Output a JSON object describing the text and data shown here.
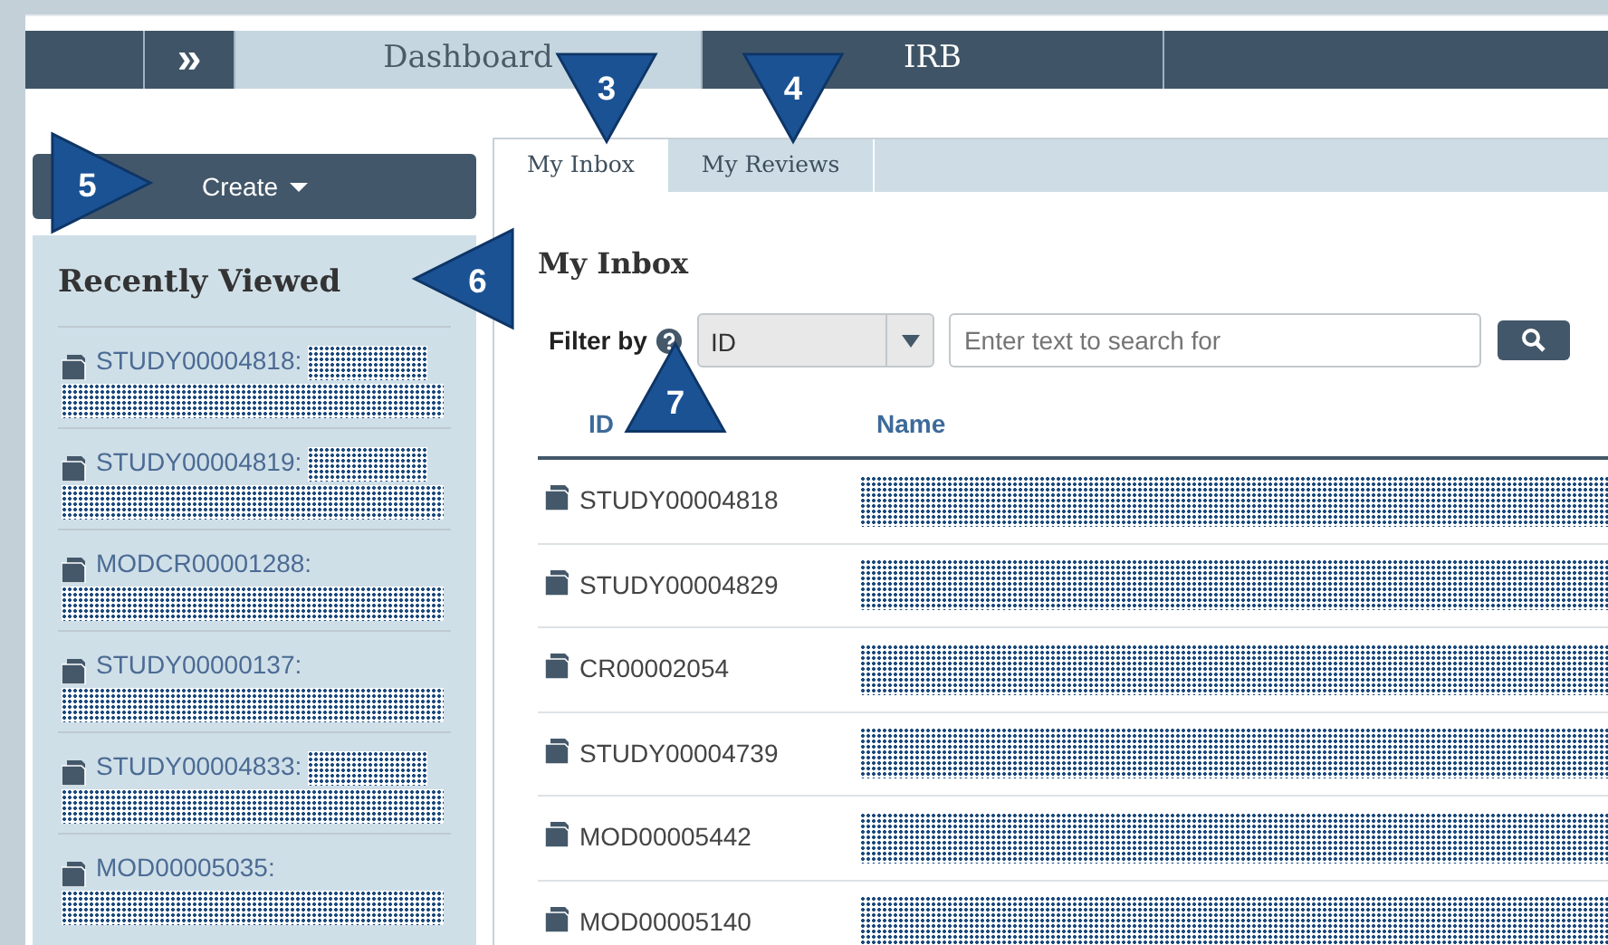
{
  "top_nav": {
    "items": [
      {
        "kind": "blank",
        "selected": false
      },
      {
        "kind": "expand",
        "label": "»",
        "selected": false
      },
      {
        "kind": "tab",
        "label": "Dashboard",
        "selected": true
      },
      {
        "kind": "tab",
        "label": "IRB",
        "selected": false
      },
      {
        "kind": "blank",
        "selected": false
      }
    ]
  },
  "sidebar": {
    "create_button": "Create",
    "title": "Recently Viewed",
    "items": [
      {
        "id": "STUDY00004818:",
        "redacted_inline": true
      },
      {
        "id": "STUDY00004819:",
        "redacted_inline": true
      },
      {
        "id": "MODCR00001288:",
        "redacted_inline": false
      },
      {
        "id": "STUDY00000137:",
        "redacted_inline": false
      },
      {
        "id": "STUDY00004833:",
        "redacted_inline": true
      },
      {
        "id": "MOD00005035:",
        "redacted_inline": false
      }
    ]
  },
  "main": {
    "tabs": [
      {
        "label": "My Inbox",
        "selected": true
      },
      {
        "label": "My Reviews",
        "selected": false
      }
    ],
    "heading": "My Inbox",
    "filter_label": "Filter by",
    "filter_select": "ID",
    "search": {
      "placeholder": "Enter text to search for"
    },
    "table": {
      "columns": [
        "ID",
        "Name"
      ],
      "rows": [
        {
          "id": "STUDY00004818",
          "name_redacted": true
        },
        {
          "id": "STUDY00004829",
          "name_redacted": true
        },
        {
          "id": "CR00002054",
          "name_redacted": true
        },
        {
          "id": "STUDY00004739",
          "name_redacted": true
        },
        {
          "id": "MOD00005442",
          "name_redacted": true
        },
        {
          "id": "MOD00005140",
          "name_redacted": true
        }
      ]
    }
  },
  "callouts": [
    {
      "label": "3",
      "kind": "down"
    },
    {
      "label": "4",
      "kind": "down"
    },
    {
      "label": "5",
      "kind": "right"
    },
    {
      "label": "6",
      "kind": "left"
    },
    {
      "label": "7",
      "kind": "up"
    }
  ]
}
